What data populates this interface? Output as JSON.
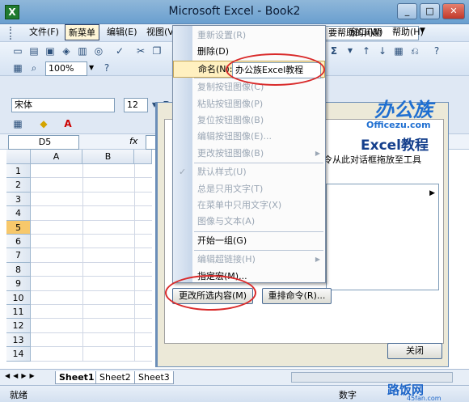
{
  "window": {
    "title": "Microsoft Excel - Book2",
    "app_icon_glyph": "X",
    "min_glyph": "_",
    "max_glyph": "□",
    "close_glyph": "✕"
  },
  "menubar": {
    "items": [
      "文件(F)",
      "新菜单",
      "编辑(E)",
      "视图(V"
    ],
    "help_label": "要帮助的问题",
    "right_items": [
      "窗口(W)",
      "帮助(H)"
    ],
    "right_fragment": "ㄷ"
  },
  "toolbar": {
    "zoom": "100%",
    "font": "宋体",
    "size": "12",
    "sum_glyph": "Σ",
    "bold": "B"
  },
  "formula": {
    "cell_ref": "D5",
    "fx": "fx"
  },
  "grid": {
    "columns": [
      "A",
      "B"
    ],
    "rows": [
      "1",
      "2",
      "3",
      "4",
      "5",
      "6",
      "7",
      "8",
      "9",
      "10",
      "11",
      "12",
      "13",
      "14"
    ],
    "selected_row": "5"
  },
  "dialog": {
    "hint_text": "令从此对话框拖放至工具",
    "change_selection_button": "更改所选内容(M)",
    "rearrange_button": "重排命令(R)...",
    "close_button": "关闭"
  },
  "context_menu": {
    "items": [
      {
        "label": "重新设置(R)",
        "disabled": true
      },
      {
        "label": "删除(D)",
        "disabled": false
      },
      {
        "label": "命名(N):",
        "disabled": false,
        "highlight": true,
        "value": "办公族Excel教程"
      },
      {
        "label": "复制按钮图像(C)",
        "disabled": true
      },
      {
        "label": "粘贴按钮图像(P)",
        "disabled": true
      },
      {
        "label": "复位按钮图像(B)",
        "disabled": true
      },
      {
        "label": "编辑按钮图像(E)...",
        "disabled": true
      },
      {
        "label": "更改按钮图像(B)",
        "disabled": true,
        "submenu": true
      },
      {
        "label": "默认样式(U)",
        "disabled": true,
        "checked": true
      },
      {
        "label": "总是只用文字(T)",
        "disabled": true
      },
      {
        "label": "在菜单中只用文字(X)",
        "disabled": true
      },
      {
        "label": "图像与文本(A)",
        "disabled": true
      },
      {
        "label": "开始一组(G)",
        "disabled": false
      },
      {
        "label": "编辑超链接(H)",
        "disabled": true,
        "submenu": true
      },
      {
        "label": "指定宏(M)...",
        "disabled": false
      }
    ]
  },
  "watermark": {
    "brand": "办公族",
    "site": "Officezu.com",
    "subtitle": "Excel教程",
    "corner_text": "路饭网",
    "corner_url": "45fan.com"
  },
  "sheets": {
    "tabs": [
      "Sheet1",
      "Sheet2",
      "Sheet3"
    ],
    "nav": [
      "◀",
      "◀",
      "▶",
      "▶"
    ]
  },
  "status": {
    "left": "就绪",
    "right": "数字"
  },
  "colors": {
    "highlight_oval": "#d92a2a",
    "selected_row": "#f7c86b"
  }
}
